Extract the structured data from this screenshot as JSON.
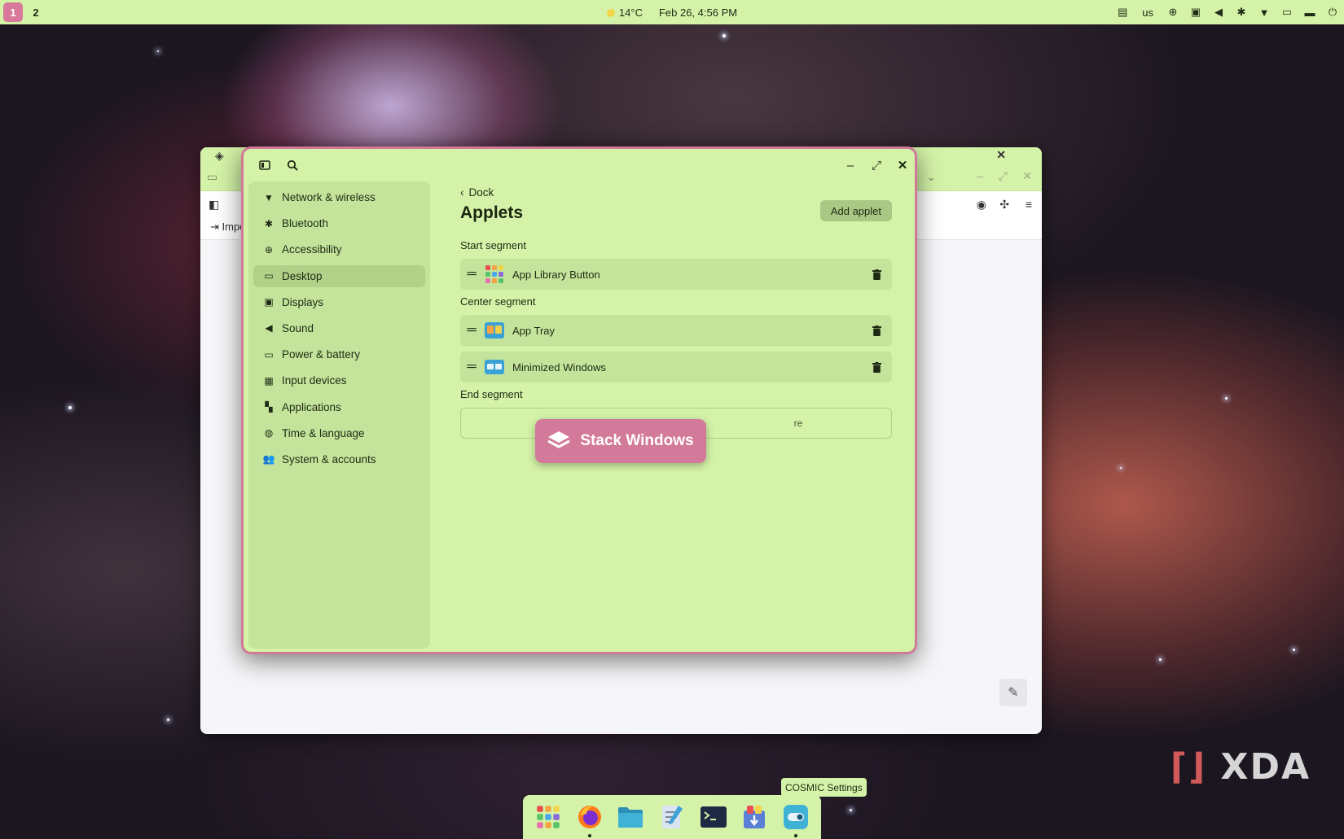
{
  "top_panel": {
    "workspaces": [
      "1",
      "2"
    ],
    "weather": "14°C",
    "datetime": "Feb 26, 4:56 PM",
    "keyboard_layout": "us",
    "tray_icons": [
      "notes-icon",
      "accessibility-icon",
      "display-icon",
      "volume-icon",
      "bluetooth-icon",
      "wifi-icon",
      "battery-icon",
      "notifications-icon",
      "power-icon"
    ]
  },
  "background_window": {
    "nav_text": "Impo"
  },
  "settings": {
    "sidebar": [
      {
        "label": "Network & wireless",
        "icon": "wifi-icon"
      },
      {
        "label": "Bluetooth",
        "icon": "bluetooth-icon"
      },
      {
        "label": "Accessibility",
        "icon": "accessibility-icon"
      },
      {
        "label": "Desktop",
        "icon": "desktop-icon",
        "active": true
      },
      {
        "label": "Displays",
        "icon": "display-icon"
      },
      {
        "label": "Sound",
        "icon": "sound-icon"
      },
      {
        "label": "Power & battery",
        "icon": "battery-icon"
      },
      {
        "label": "Input devices",
        "icon": "keyboard-icon"
      },
      {
        "label": "Applications",
        "icon": "apps-grid-icon"
      },
      {
        "label": "Time & language",
        "icon": "globe-icon"
      },
      {
        "label": "System & accounts",
        "icon": "users-icon"
      }
    ],
    "back_label": "Dock",
    "page_title": "Applets",
    "add_button": "Add applet",
    "segments": {
      "start": {
        "label": "Start segment",
        "applets": [
          "App Library Button"
        ]
      },
      "center": {
        "label": "Center segment",
        "applets": [
          "App Tray",
          "Minimized Windows"
        ]
      },
      "end": {
        "label": "End segment",
        "drop_text": "re"
      }
    }
  },
  "overlay": {
    "label": "Stack Windows"
  },
  "dock": {
    "tooltip": "COSMIC Settings",
    "items": [
      "app-library-icon",
      "firefox-icon",
      "files-icon",
      "text-editor-icon",
      "terminal-icon",
      "store-icon",
      "settings-icon"
    ]
  },
  "watermark": "XDA"
}
